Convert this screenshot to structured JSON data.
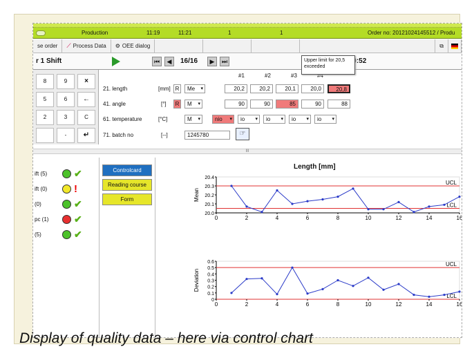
{
  "caption": "Display of quality data – here via control chart",
  "statusbar": {
    "type": "Production",
    "time1": "11:19",
    "time2": "11:21",
    "count1": "1",
    "count2": "1",
    "order": "Order no: 20121024145512 / Produ"
  },
  "tabs": [
    "se order",
    "Process Data",
    "OEE dialog"
  ],
  "title": {
    "shift": "r 1 Shift",
    "pager": "16/16",
    "datetime": "10.02.2013 11:20:52"
  },
  "tooltip": "Upper limit for 20,5 exceeded",
  "keypad": [
    "8",
    "9",
    "×",
    "5",
    "6",
    "←",
    "2",
    "3",
    "C",
    "",
    "-",
    "↵"
  ],
  "form": {
    "col_headers": [
      "#1",
      "#2",
      "#3",
      "#4",
      "#5"
    ],
    "rows": [
      {
        "label": "21. length",
        "unit": "[mm]",
        "flag": "R",
        "flag_red": false,
        "mode": "Me",
        "values": [
          "20,2",
          "20,2",
          "20,1",
          "20,0",
          "20,8"
        ]
      },
      {
        "label": "41. angle",
        "unit": "[°]",
        "flag": "R",
        "flag_red": true,
        "mode": "M",
        "values": [
          "90",
          "90",
          "85",
          "90",
          "88"
        ]
      },
      {
        "label": "61. temperature",
        "unit": "[°C]",
        "mode": "M",
        "values": [
          "nio",
          "io",
          "io",
          "io",
          "io"
        ]
      },
      {
        "label": "71. batch no",
        "unit": "[--]",
        "values": [
          "1245780"
        ]
      }
    ]
  },
  "status_rows": [
    {
      "label": "ift (5)",
      "face": "happy",
      "color": "#4cc22a",
      "mark": "check"
    },
    {
      "label": "ift (0)",
      "face": "neutral",
      "color": "#f2e82a",
      "mark": "bang"
    },
    {
      "label": "(0)",
      "face": "happy",
      "color": "#4cc22a",
      "mark": "check"
    },
    {
      "label": "pc (1)",
      "face": "sad",
      "color": "#e83030",
      "mark": "check"
    },
    {
      "label": "(5)",
      "face": "happy",
      "color": "#4cc22a",
      "mark": "check"
    }
  ],
  "modes": [
    "Controlcard",
    "Reading course",
    "Form"
  ],
  "chart_data": [
    {
      "type": "line",
      "title": "Length [mm]",
      "ylabel": "Mean",
      "x": [
        1,
        2,
        3,
        4,
        5,
        6,
        7,
        8,
        9,
        10,
        11,
        12,
        13,
        14,
        15,
        16
      ],
      "series": [
        {
          "values": [
            20.3,
            20.07,
            20.01,
            20.25,
            20.1,
            20.13,
            20.15,
            20.18,
            20.27,
            20.04,
            20.04,
            20.12,
            20.01,
            20.07,
            20.09,
            20.18
          ]
        }
      ],
      "ucl": 20.3,
      "lcl": 20.05,
      "xlim": [
        0,
        16
      ],
      "ylim": [
        20.0,
        20.4
      ],
      "xticks": [
        0,
        2,
        4,
        6,
        8,
        10,
        12,
        14,
        16
      ],
      "yticks": [
        "20.0",
        "20.1",
        "20.2",
        "20.3",
        "20.4"
      ]
    },
    {
      "type": "line",
      "ylabel": "Deviation",
      "x": [
        1,
        2,
        3,
        4,
        5,
        6,
        7,
        8,
        9,
        10,
        11,
        12,
        13,
        14,
        15,
        16
      ],
      "series": [
        {
          "values": [
            0.1,
            0.32,
            0.33,
            0.08,
            0.5,
            0.09,
            0.16,
            0.3,
            0.21,
            0.34,
            0.15,
            0.24,
            0.07,
            0.04,
            0.07,
            0.12
          ]
        }
      ],
      "ucl": 0.5,
      "lcl": 0.0,
      "xlim": [
        0,
        16
      ],
      "ylim": [
        0,
        0.6
      ],
      "xticks": [
        0,
        2,
        4,
        6,
        8,
        10,
        12,
        14,
        16
      ],
      "yticks": [
        "0",
        "0.1",
        "0.2",
        "0.3",
        "0.4",
        "0.5",
        "0.6"
      ]
    }
  ],
  "labels": {
    "ucl": "UCL",
    "lcl": "LCL",
    "scroll": "III"
  }
}
